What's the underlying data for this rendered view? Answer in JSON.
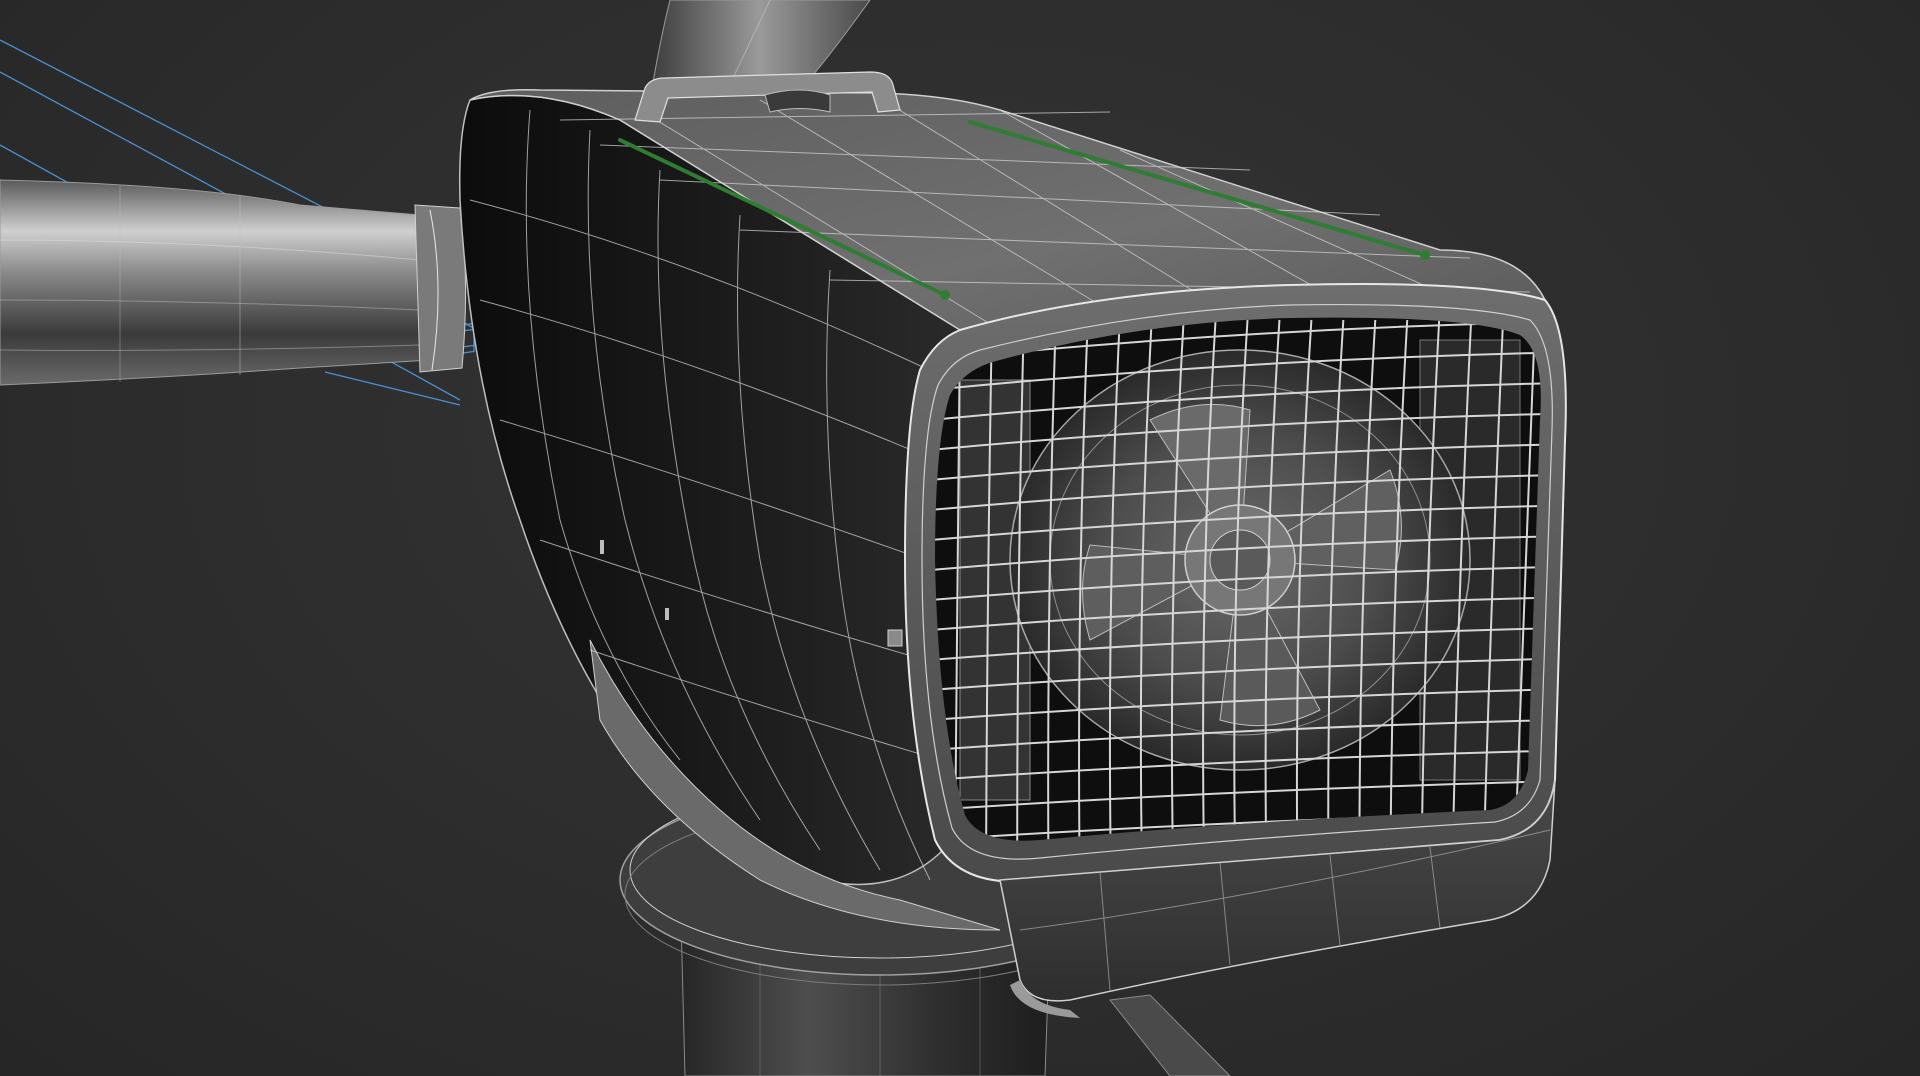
{
  "viewport": {
    "background_color": "#2d2d2d",
    "wire_color": "#c8c8c8",
    "selection_color": "#2e7d32",
    "gizmo_color": "#4a8fd0"
  },
  "scene": {
    "objects": [
      "rotor-hub-arm",
      "nacelle-housing",
      "fan-grille",
      "fan-blades",
      "roof-handle",
      "roof-rail-left",
      "roof-rail-right",
      "yaw-bearing",
      "tower-column",
      "light-gizmo"
    ]
  }
}
